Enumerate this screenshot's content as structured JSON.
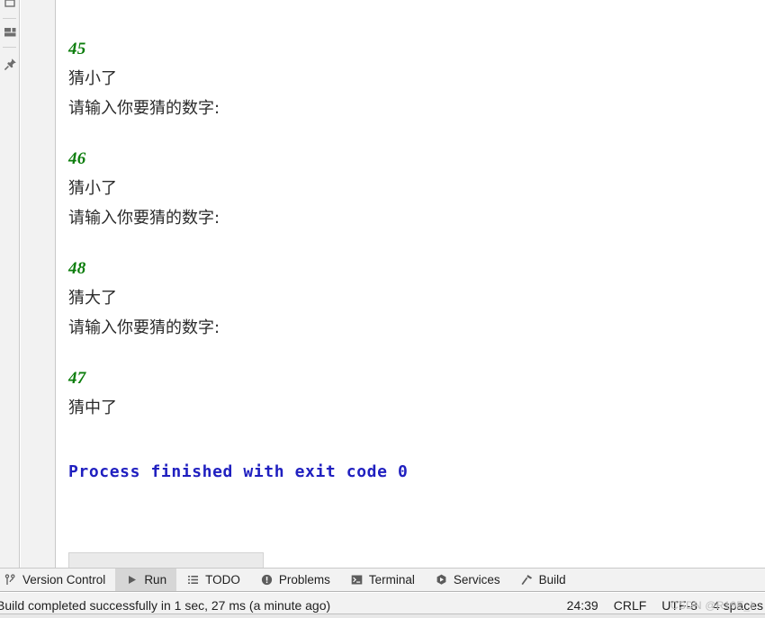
{
  "sidebar": {
    "icons": [
      {
        "name": "structure-icon",
        "glyph": "▭"
      },
      {
        "name": "layout-icon",
        "glyph": "▥"
      },
      {
        "name": "pin-icon",
        "glyph": "📌"
      }
    ]
  },
  "console": {
    "blocks": [
      {
        "input": "45",
        "result": "猜小了",
        "prompt": "请输入你要猜的数字:"
      },
      {
        "input": "46",
        "result": "猜小了",
        "prompt": "请输入你要猜的数字:"
      },
      {
        "input": "48",
        "result": "猜大了",
        "prompt": "请输入你要猜的数字:"
      },
      {
        "input": "47",
        "result": "猜中了",
        "prompt": ""
      }
    ],
    "exit_message": "Process finished with exit code 0"
  },
  "toolbar": {
    "items": [
      {
        "label": "Version Control",
        "icon": "branch-icon",
        "active": false
      },
      {
        "label": "Run",
        "icon": "play-icon",
        "active": true
      },
      {
        "label": "TODO",
        "icon": "list-icon",
        "active": false
      },
      {
        "label": "Problems",
        "icon": "warning-circle-icon",
        "active": false
      },
      {
        "label": "Terminal",
        "icon": "terminal-icon",
        "active": false
      },
      {
        "label": "Services",
        "icon": "services-icon",
        "active": false
      },
      {
        "label": "Build",
        "icon": "hammer-icon",
        "active": false
      }
    ]
  },
  "statusbar": {
    "build_message": "Build completed successfully in 1 sec, 27 ms (a minute ago)",
    "caret_position": "24:39",
    "line_separator": "CRLF",
    "encoding": "UTF-8",
    "indent": "4 spaces",
    "watermark": "CSDN @R19E_I"
  },
  "colors": {
    "input_green": "#0b7d0b",
    "exit_blue": "#2020c0",
    "panel_gray": "#f2f2f2",
    "active_tab": "#d6d6d6"
  }
}
